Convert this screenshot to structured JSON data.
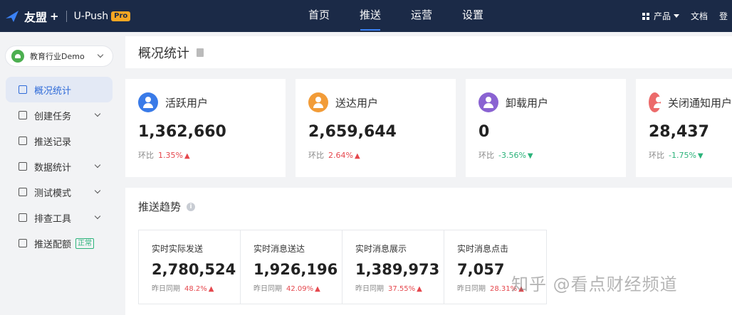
{
  "header": {
    "brand": "友盟",
    "brand_plus": "+",
    "product": "U-Push",
    "pro_badge": "Pro",
    "nav": [
      {
        "label": "首页",
        "active": false
      },
      {
        "label": "推送",
        "active": true
      },
      {
        "label": "运营",
        "active": false
      },
      {
        "label": "设置",
        "active": false
      }
    ],
    "products_label": "产品",
    "docs_label": "文档",
    "login_label": "登"
  },
  "sidebar": {
    "app_name": "教育行业Demo",
    "items": [
      {
        "label": "概况统计",
        "active": true
      },
      {
        "label": "创建任务",
        "expandable": true
      },
      {
        "label": "推送记录"
      },
      {
        "label": "数据统计",
        "expandable": true
      },
      {
        "label": "测试模式",
        "expandable": true
      },
      {
        "label": "排查工具",
        "expandable": true
      },
      {
        "label": "推送配额",
        "badge": "正常"
      }
    ]
  },
  "main": {
    "page_title": "概况统计",
    "stats": [
      {
        "label": "活跃用户",
        "value": "1,362,660",
        "trend_label": "环比",
        "trend_value": "1.35%",
        "direction": "up",
        "color": "#3a7be8"
      },
      {
        "label": "送达用户",
        "value": "2,659,644",
        "trend_label": "环比",
        "trend_value": "2.64%",
        "direction": "up",
        "color": "#f29c38"
      },
      {
        "label": "卸载用户",
        "value": "0",
        "trend_label": "环比",
        "trend_value": "-3.56%",
        "direction": "down",
        "color": "#8a63d2"
      },
      {
        "label": "关闭通知用户",
        "value": "28,437",
        "trend_label": "环比",
        "trend_value": "-1.75%",
        "direction": "down",
        "color": "#ec6b6b"
      }
    ],
    "trend": {
      "title": "推送趋势",
      "info_icon": "i",
      "cells": [
        {
          "label": "实时实际发送",
          "value": "2,780,524",
          "compare_label": "昨日同期",
          "compare_value": "48.2%"
        },
        {
          "label": "实时消息送达",
          "value": "1,926,196",
          "compare_label": "昨日同期",
          "compare_value": "42.09%"
        },
        {
          "label": "实时消息展示",
          "value": "1,389,973",
          "compare_label": "昨日同期",
          "compare_value": "37.55%"
        },
        {
          "label": "实时消息点击",
          "value": "7,057",
          "compare_label": "昨日同期",
          "compare_value": "28.31%"
        }
      ]
    }
  },
  "watermark": "知乎 @看点财经频道",
  "colors": {
    "topbar": "#1b2a47",
    "accent": "#2f6bd8",
    "up": "#e5474d",
    "down": "#2bb37a"
  }
}
